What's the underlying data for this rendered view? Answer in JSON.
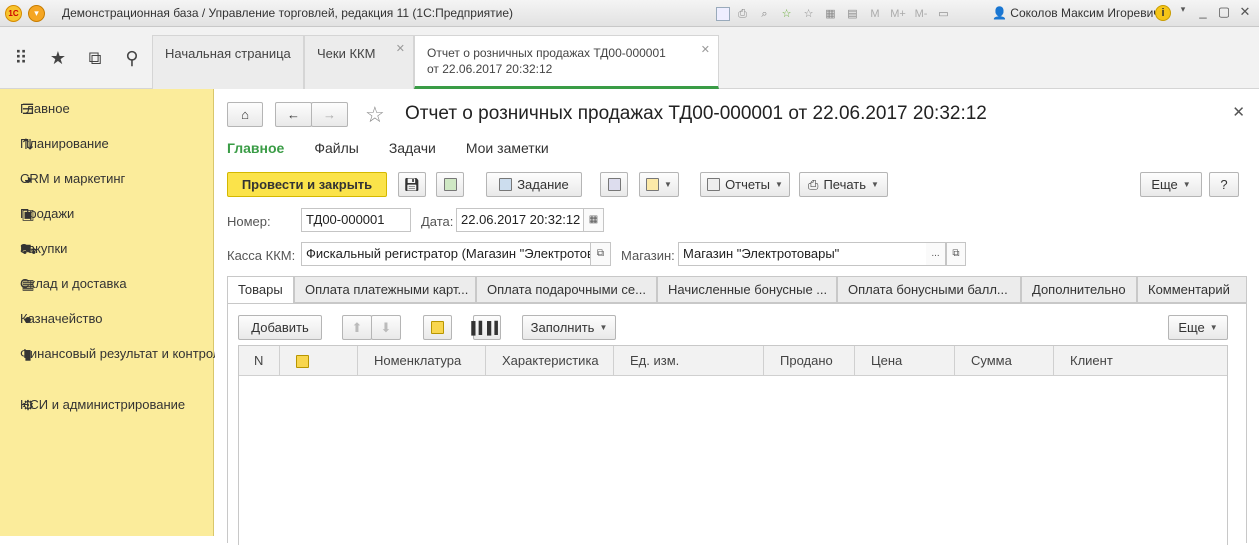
{
  "app": {
    "title": "Демонстрационная база / Управление торговлей, редакция 11  (1С:Предприятие)",
    "user": "Соколов Максим Игоревич",
    "logo_text": "1С"
  },
  "titlebar_icons": {
    "m": "M",
    "m_plus": "M+",
    "m_minus": "M-"
  },
  "tabs": [
    {
      "label": "Начальная страница"
    },
    {
      "label": "Чеки ККМ"
    },
    {
      "label": "Отчет о розничных продажах ТД00-000001",
      "label2": "от 22.06.2017 20:32:12"
    }
  ],
  "sidebar": {
    "items": [
      {
        "label": "Главное",
        "icon": "menu-icon"
      },
      {
        "label": "Планирование",
        "icon": "planning-icon"
      },
      {
        "label": "CRM и маркетинг",
        "icon": "pie-chart-icon"
      },
      {
        "label": "Продажи",
        "icon": "bag-icon"
      },
      {
        "label": "Закупки",
        "icon": "cart-icon"
      },
      {
        "label": "Склад и доставка",
        "icon": "warehouse-icon"
      },
      {
        "label": "Казначейство",
        "icon": "coin-icon"
      },
      {
        "label": "Финансовый результат и контроллинг",
        "icon": "bar-chart-icon"
      },
      {
        "label": "НСИ и администрирование",
        "icon": "gear-icon"
      }
    ]
  },
  "doc": {
    "title": "Отчет о розничных продажах ТД00-000001 от 22.06.2017 20:32:12",
    "sections": [
      "Главное",
      "Файлы",
      "Задачи",
      "Мои заметки"
    ],
    "toolbar": {
      "post_close": "Провести и закрыть",
      "task": "Задание",
      "reports": "Отчеты",
      "print": "Печать",
      "more": "Еще",
      "help": "?"
    },
    "number_label": "Номер:",
    "number_value": "ТД00-000001",
    "date_label": "Дата:",
    "date_value": "22.06.2017 20:32:12",
    "kassa_label": "Касса ККМ:",
    "kassa_value": "Фискальный регистратор (Магазин \"Электротов",
    "store_label": "Магазин:",
    "store_value": "Магазин \"Электротовары\"",
    "store_dots": "...",
    "doc_tabs": [
      "Товары",
      "Оплата платежными карт...",
      "Оплата подарочными се...",
      "Начисленные бонусные ...",
      "Оплата бонусными балл...",
      "Дополнительно",
      "Комментарий"
    ],
    "table_toolbar": {
      "add": "Добавить",
      "fill": "Заполнить",
      "more": "Еще"
    },
    "columns": [
      "N",
      "",
      "Номенклатура",
      "Характеристика",
      "Ед. изм.",
      "Продано",
      "Цена",
      "Сумма",
      "Клиент"
    ]
  }
}
